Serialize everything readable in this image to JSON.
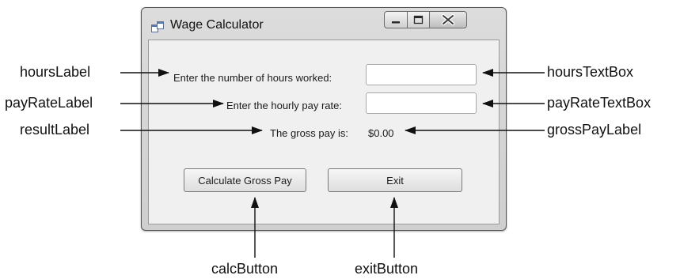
{
  "window": {
    "title": "Wage Calculator",
    "icons": [
      "form-icon",
      "minimize-icon",
      "maximize-icon",
      "close-icon"
    ]
  },
  "form": {
    "hours_prompt": "Enter the number of hours worked:",
    "rate_prompt": "Enter the hourly pay rate:",
    "result_prompt": "The gross pay is:",
    "gross_pay_value": "$0.00",
    "hours_value": "",
    "rate_value": "",
    "calc_button_label": "Calculate Gross Pay",
    "exit_button_label": "Exit"
  },
  "callouts": {
    "hoursLabel": "hoursLabel",
    "payRateLabel": "payRateLabel",
    "resultLabel": "resultLabel",
    "hoursTextBox": "hoursTextBox",
    "payRateTextBox": "payRateTextBox",
    "grossPayLabel": "grossPayLabel",
    "calcButton": "calcButton",
    "exitButton": "exitButton"
  }
}
